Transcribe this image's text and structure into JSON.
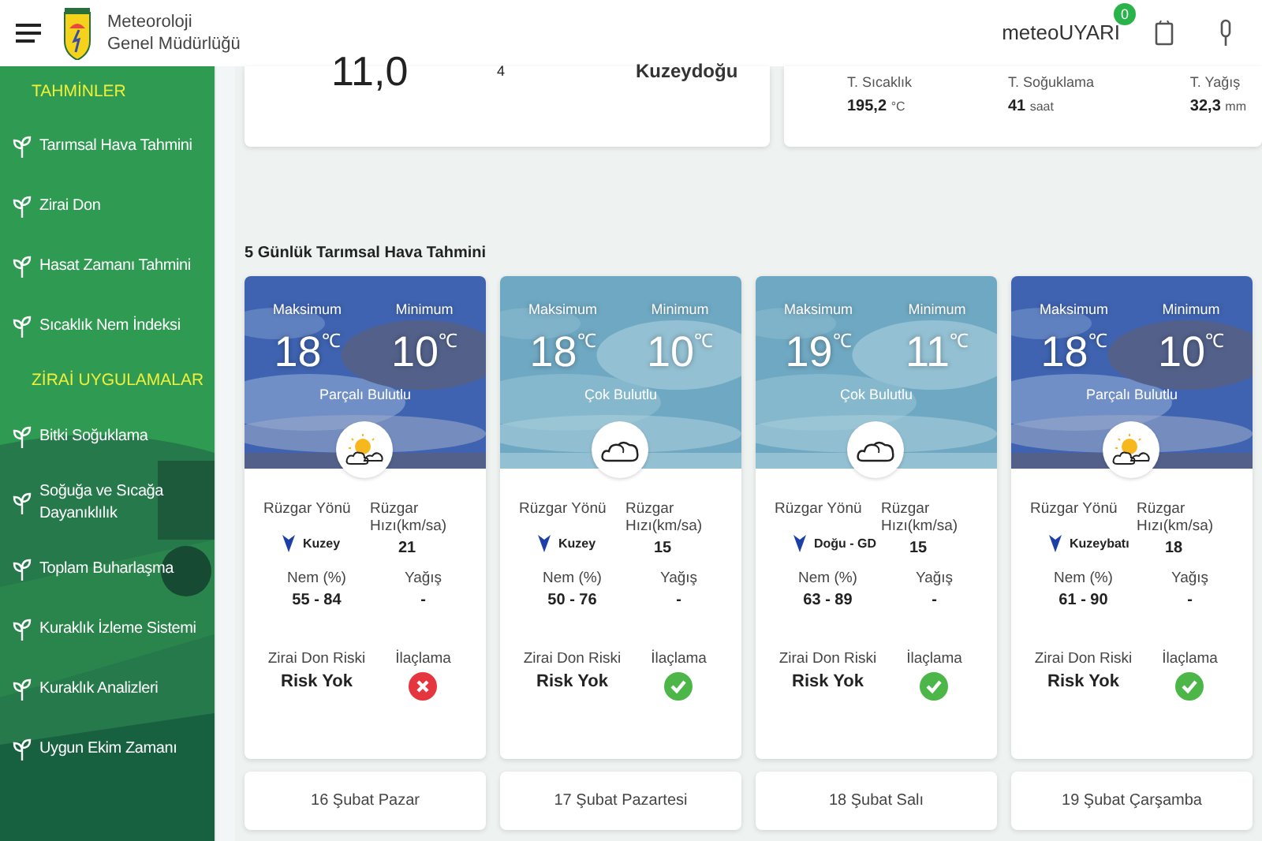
{
  "header": {
    "title_lines": [
      "Meteoroloji",
      "Genel Müdürlüğü"
    ],
    "alert_brand": "meteoUYARI",
    "alert_count": "0"
  },
  "sidebar": {
    "sections": [
      {
        "title": "TAHMİNLER",
        "items": [
          {
            "label": "Tarımsal Hava Tahmini"
          },
          {
            "label": "Zirai Don"
          },
          {
            "label": "Hasat Zamanı Tahmini"
          },
          {
            "label": "Sıcaklık Nem İndeksi"
          }
        ]
      },
      {
        "title": "ZİRAİ UYGULAMALAR",
        "items": [
          {
            "label": "Bitki Soğuklama"
          },
          {
            "label": "Soğuğa ve Sıcağa Dayanıklılık"
          },
          {
            "label": "Toplam Buharlaşma"
          },
          {
            "label": "Kuraklık İzleme Sistemi"
          },
          {
            "label": "Kuraklık Analizleri"
          },
          {
            "label": "Uygun Ekim Zamanı"
          }
        ]
      }
    ]
  },
  "current": {
    "temperature": "11,0",
    "wind_speed": "4",
    "wind_direction": "Kuzeydoğu"
  },
  "totals": [
    {
      "label": "T. Sıcaklık",
      "value": "195,2",
      "unit": "°C"
    },
    {
      "label": "T. Soğuklama",
      "value": "41",
      "unit": "saat"
    },
    {
      "label": "T. Yağış",
      "value": "32,3",
      "unit": "mm"
    }
  ],
  "forecast": {
    "title": "5 Günlük Tarımsal Hava Tahmini",
    "days": [
      {
        "labels": {
          "max": "Maksimum",
          "min": "Minimum",
          "wind_dir": "Rüzgar Yönü",
          "wind_speed": "Rüzgar Hızı(km/sa)",
          "humidity": "Nem (%)",
          "rain": "Yağış",
          "frost": "Zirai Don Riski",
          "spray": "İlaçlama"
        },
        "max": "18",
        "min": "10",
        "max_unit": "℃",
        "min_unit": "℃",
        "condition": "Parçalı Bulutlu",
        "kind": "partly",
        "wind_dir": "Kuzey",
        "wind_speed": "21",
        "humidity": "55 - 84",
        "rain": "-",
        "frost": "Risk Yok",
        "spray_ok": false,
        "date": "16 Şubat Pazar"
      },
      {
        "labels": {
          "max": "Maksimum",
          "min": "Minimum",
          "wind_dir": "Rüzgar Yönü",
          "wind_speed": "Rüzgar Hızı(km/sa)",
          "humidity": "Nem (%)",
          "rain": "Yağış",
          "frost": "Zirai Don Riski",
          "spray": "İlaçlama"
        },
        "max": "18",
        "min": "10",
        "max_unit": "℃",
        "min_unit": "℃",
        "condition": "Çok Bulutlu",
        "kind": "cloudy",
        "wind_dir": "Kuzey",
        "wind_speed": "15",
        "humidity": "50 - 76",
        "rain": "-",
        "frost": "Risk Yok",
        "spray_ok": true,
        "date": "17 Şubat Pazartesi"
      },
      {
        "labels": {
          "max": "Maksimum",
          "min": "Minimum",
          "wind_dir": "Rüzgar Yönü",
          "wind_speed": "Rüzgar Hızı(km/sa)",
          "humidity": "Nem (%)",
          "rain": "Yağış",
          "frost": "Zirai Don Riski",
          "spray": "İlaçlama"
        },
        "max": "19",
        "min": "11",
        "max_unit": "℃",
        "min_unit": "℃",
        "condition": "Çok Bulutlu",
        "kind": "cloudy",
        "wind_dir": "Doğu - GD",
        "wind_speed": "15",
        "humidity": "63 - 89",
        "rain": "-",
        "frost": "Risk Yok",
        "spray_ok": true,
        "date": "18 Şubat Salı"
      },
      {
        "labels": {
          "max": "Maksimum",
          "min": "Minimum",
          "wind_dir": "Rüzgar Yönü",
          "wind_speed": "Rüzgar Hızı(km/sa)",
          "humidity": "Nem (%)",
          "rain": "Yağış",
          "frost": "Zirai Don Riski",
          "spray": "İlaçlama"
        },
        "max": "18",
        "min": "10",
        "max_unit": "℃",
        "min_unit": "℃",
        "condition": "Parçalı Bulutlu",
        "kind": "partly",
        "wind_dir": "Kuzeybatı",
        "wind_speed": "18",
        "humidity": "61 - 90",
        "rain": "-",
        "frost": "Risk Yok",
        "spray_ok": true,
        "date": "19 Şubat Çarşamba"
      }
    ]
  }
}
